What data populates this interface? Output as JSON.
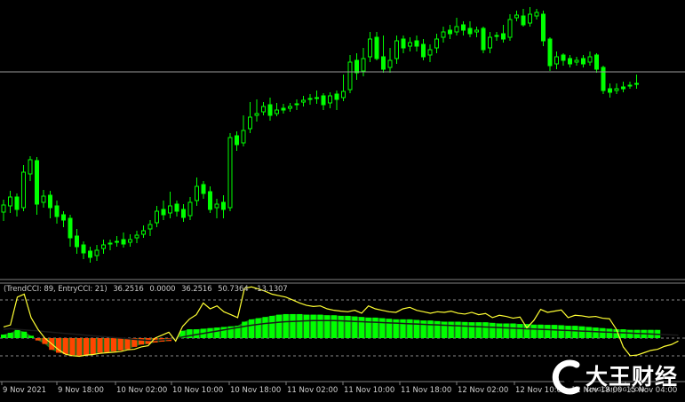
{
  "chart_data": [
    {
      "type": "candlestick",
      "title": "",
      "colors": {
        "up": "#00ff00",
        "down": "#00ff00",
        "background": "#000000"
      },
      "horizontal_line": {
        "level": 81,
        "color": "#9a9a9a"
      },
      "candles": [
        [
          239,
          231,
          249,
          225
        ],
        [
          232,
          222,
          240,
          215
        ],
        [
          222,
          236,
          244,
          218
        ],
        [
          234,
          194,
          238,
          186
        ],
        [
          196,
          180,
          204,
          176
        ],
        [
          181,
          230,
          242,
          177
        ],
        [
          228,
          221,
          234,
          214
        ],
        [
          220,
          234,
          246,
          215
        ],
        [
          232,
          244,
          252,
          226
        ],
        [
          242,
          248,
          256,
          238
        ],
        [
          246,
          268,
          278,
          242
        ],
        [
          266,
          278,
          286,
          258
        ],
        [
          276,
          285,
          292,
          272
        ],
        [
          283,
          290,
          296,
          278
        ],
        [
          288,
          282,
          294,
          276
        ],
        [
          280,
          276,
          286,
          270
        ],
        [
          275,
          274,
          282,
          270
        ],
        [
          272,
          272,
          278,
          266
        ],
        [
          270,
          275,
          279,
          262
        ],
        [
          273,
          270,
          278,
          264
        ],
        [
          268,
          265,
          274,
          260
        ],
        [
          264,
          260,
          268,
          254
        ],
        [
          258,
          253,
          266,
          248
        ],
        [
          251,
          238,
          256,
          232
        ],
        [
          236,
          242,
          248,
          226
        ],
        [
          240,
          232,
          246,
          216
        ],
        [
          230,
          238,
          244,
          226
        ],
        [
          236,
          245,
          250,
          230
        ],
        [
          243,
          228,
          248,
          222
        ],
        [
          226,
          210,
          232,
          200
        ],
        [
          208,
          218,
          224,
          204
        ],
        [
          216,
          236,
          240,
          210
        ],
        [
          234,
          230,
          246,
          224
        ],
        [
          228,
          236,
          246,
          220
        ],
        [
          234,
          155,
          238,
          150
        ],
        [
          153,
          163,
          170,
          148
        ],
        [
          161,
          147,
          165,
          130
        ],
        [
          145,
          132,
          150,
          115
        ],
        [
          130,
          128,
          137,
          112
        ],
        [
          126,
          120,
          130,
          115
        ],
        [
          118,
          130,
          136,
          110
        ],
        [
          128,
          124,
          131,
          116
        ],
        [
          122,
          124,
          128,
          117
        ],
        [
          122,
          120,
          126,
          116
        ],
        [
          118,
          117,
          124,
          112
        ],
        [
          115,
          113,
          120,
          108
        ],
        [
          111,
          112,
          118,
          106
        ],
        [
          110,
          110,
          117,
          102
        ],
        [
          108,
          118,
          124,
          105
        ],
        [
          116,
          108,
          122,
          104
        ],
        [
          106,
          112,
          124,
          102
        ],
        [
          110,
          103,
          114,
          84
        ],
        [
          101,
          70,
          105,
          62
        ],
        [
          68,
          82,
          90,
          60
        ],
        [
          80,
          66,
          86,
          54
        ],
        [
          64,
          44,
          70,
          36
        ],
        [
          42,
          66,
          68,
          36
        ],
        [
          64,
          78,
          82,
          40
        ],
        [
          76,
          68,
          82,
          54
        ],
        [
          66,
          46,
          72,
          40
        ],
        [
          44,
          54,
          60,
          40
        ],
        [
          52,
          48,
          58,
          42
        ],
        [
          46,
          52,
          58,
          40
        ],
        [
          50,
          64,
          68,
          44
        ],
        [
          62,
          56,
          70,
          50
        ],
        [
          54,
          44,
          60,
          38
        ],
        [
          42,
          36,
          48,
          30
        ],
        [
          34,
          38,
          44,
          28
        ],
        [
          36,
          30,
          40,
          20
        ],
        [
          28,
          34,
          40,
          24
        ],
        [
          32,
          38,
          42,
          24
        ],
        [
          36,
          34,
          42,
          30
        ],
        [
          32,
          56,
          60,
          30
        ],
        [
          54,
          42,
          60,
          36
        ],
        [
          40,
          40,
          46,
          36
        ],
        [
          38,
          44,
          48,
          28
        ],
        [
          42,
          22,
          46,
          16
        ],
        [
          20,
          17,
          24,
          12
        ],
        [
          18,
          28,
          30,
          10
        ],
        [
          26,
          16,
          30,
          8
        ],
        [
          18,
          14,
          22,
          10
        ],
        [
          16,
          46,
          52,
          12
        ],
        [
          44,
          74,
          80,
          42
        ],
        [
          72,
          64,
          78,
          58
        ],
        [
          62,
          68,
          74,
          60
        ],
        [
          66,
          72,
          76,
          62
        ],
        [
          70,
          68,
          74,
          64
        ],
        [
          66,
          72,
          76,
          62
        ],
        [
          70,
          64,
          74,
          58
        ],
        [
          62,
          78,
          82,
          60
        ],
        [
          76,
          102,
          106,
          74
        ],
        [
          100,
          104,
          110,
          94
        ],
        [
          102,
          100,
          106,
          94
        ],
        [
          98,
          100,
          104,
          92
        ],
        [
          96,
          96,
          100,
          92
        ],
        [
          94,
          94,
          100,
          84
        ]
      ]
    },
    {
      "type": "histogram+line",
      "indicator_label": {
        "name": "(TrendCCI: 89, EntryCCI: 21)",
        "values": [
          "36.2516",
          "0.0000",
          "36.2516",
          "50.7364",
          "-13.1307"
        ]
      },
      "zero_level": 0,
      "colors": {
        "positive_bars": "#00ff00",
        "negative_bars": "#ff4500",
        "area": "#33cc33",
        "entry_line": "#ffff33",
        "trend_line": "#1a1a1a"
      },
      "hist": [
        12,
        18,
        28,
        22,
        8,
        -8,
        -20,
        -40,
        -50,
        -55,
        -58,
        -60,
        -58,
        -55,
        -50,
        -48,
        -45,
        -42,
        -38,
        -30,
        -22,
        -20,
        -15,
        -12,
        -10,
        0,
        25,
        30,
        30,
        32,
        34,
        36,
        38,
        40,
        42,
        56,
        64,
        68,
        72,
        76,
        80,
        82,
        82,
        82,
        80,
        80,
        80,
        78,
        78,
        76,
        76,
        74,
        72,
        70,
        70,
        68,
        66,
        64,
        64,
        64,
        62,
        60,
        60,
        58,
        56,
        56,
        56,
        55,
        54,
        54,
        54,
        52,
        50,
        50,
        50,
        48,
        48,
        46,
        46,
        45,
        45,
        44,
        42,
        42,
        40,
        38,
        36,
        34,
        32,
        30,
        30,
        28,
        28,
        28,
        28,
        28
      ],
      "entry_cci": [
        38,
        45,
        140,
        150,
        70,
        30,
        0,
        -20,
        -40,
        -55,
        -60,
        -62,
        -58,
        -56,
        -52,
        -50,
        -48,
        -46,
        -40,
        -38,
        -30,
        -26,
        0,
        10,
        20,
        -10,
        40,
        65,
        80,
        120,
        100,
        110,
        90,
        80,
        70,
        170,
        175,
        168,
        160,
        150,
        145,
        140,
        130,
        120,
        112,
        108,
        110,
        100,
        95,
        92,
        90,
        95,
        85,
        110,
        100,
        95,
        90,
        88,
        100,
        105,
        95,
        90,
        85,
        90,
        88,
        92,
        85,
        82,
        88,
        80,
        84,
        70,
        78,
        74,
        68,
        72,
        35,
        60,
        98,
        88,
        92,
        96,
        70,
        78,
        76,
        72,
        74,
        68,
        66,
        30,
        -30,
        -60,
        -58,
        -50,
        -42,
        -38,
        -28,
        -22,
        -10
      ],
      "trend_cci": [
        30,
        32,
        30,
        28,
        26,
        25,
        22,
        20,
        18,
        16,
        14,
        12,
        10,
        8,
        6,
        4,
        2,
        0,
        -2,
        -4,
        -6,
        -8,
        -8,
        -6,
        -4,
        -2,
        4,
        8,
        12,
        16,
        20,
        24,
        28,
        32,
        36,
        40,
        44,
        47,
        50,
        52,
        54,
        56,
        57,
        58,
        59,
        60,
        60,
        60,
        60,
        59,
        58,
        57,
        56,
        55,
        54,
        53,
        52,
        51,
        50,
        49,
        48,
        47,
        46,
        45,
        44,
        43,
        42,
        41,
        40,
        39,
        38,
        37,
        36,
        35,
        34,
        33,
        32,
        31,
        30,
        29,
        28,
        27,
        26,
        25,
        24,
        23,
        22,
        21,
        20,
        19,
        18,
        17,
        16,
        15,
        14,
        13,
        12,
        11,
        10
      ]
    }
  ],
  "x_axis": {
    "labels": [
      "9 Nov 2021",
      "9 Nov 18:00",
      "10 Nov 02:00",
      "10 Nov 10:00",
      "10 Nov 18:00",
      "11 Nov 02:00",
      "11 Nov 10:00",
      "11 Nov 18:00",
      "12 Nov 02:00",
      "12 Nov 10:00",
      "12 Nov 18:00",
      "15 Nov 04:00"
    ]
  },
  "watermark": {
    "brand": "大王财经",
    "domain": "KINGCAIJING.COM"
  }
}
